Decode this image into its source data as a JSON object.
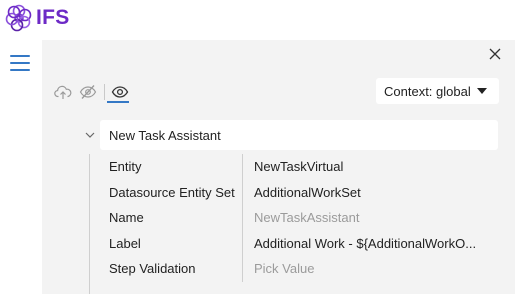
{
  "brand": {
    "name": "IFS",
    "color": "#6d2ac6"
  },
  "colors": {
    "accent": "#3478c5",
    "panel_bg": "#f3f3f3",
    "muted_text": "#9b9b9b"
  },
  "icons": {
    "menu": "hamburger-menu-icon",
    "close": "close-icon",
    "toolbar": [
      "cloud-upload-icon",
      "eye-off-icon",
      "eye-icon"
    ],
    "expand": "chevron-down-icon",
    "dropdown": "caret-down-icon"
  },
  "context": {
    "label": "Context: global"
  },
  "node": {
    "title": "New Task Assistant",
    "expanded": true,
    "properties": [
      {
        "key": "Entity",
        "value": "NewTaskVirtual",
        "placeholder": false
      },
      {
        "key": "Datasource Entity Set",
        "value": "AdditionalWorkSet",
        "placeholder": false
      },
      {
        "key": "Name",
        "value": "NewTaskAssistant",
        "placeholder": true
      },
      {
        "key": "Label",
        "value": "Additional Work - ${AdditionalWorkO...",
        "placeholder": false
      },
      {
        "key": "Step Validation",
        "value": "Pick Value",
        "placeholder": true
      }
    ]
  }
}
